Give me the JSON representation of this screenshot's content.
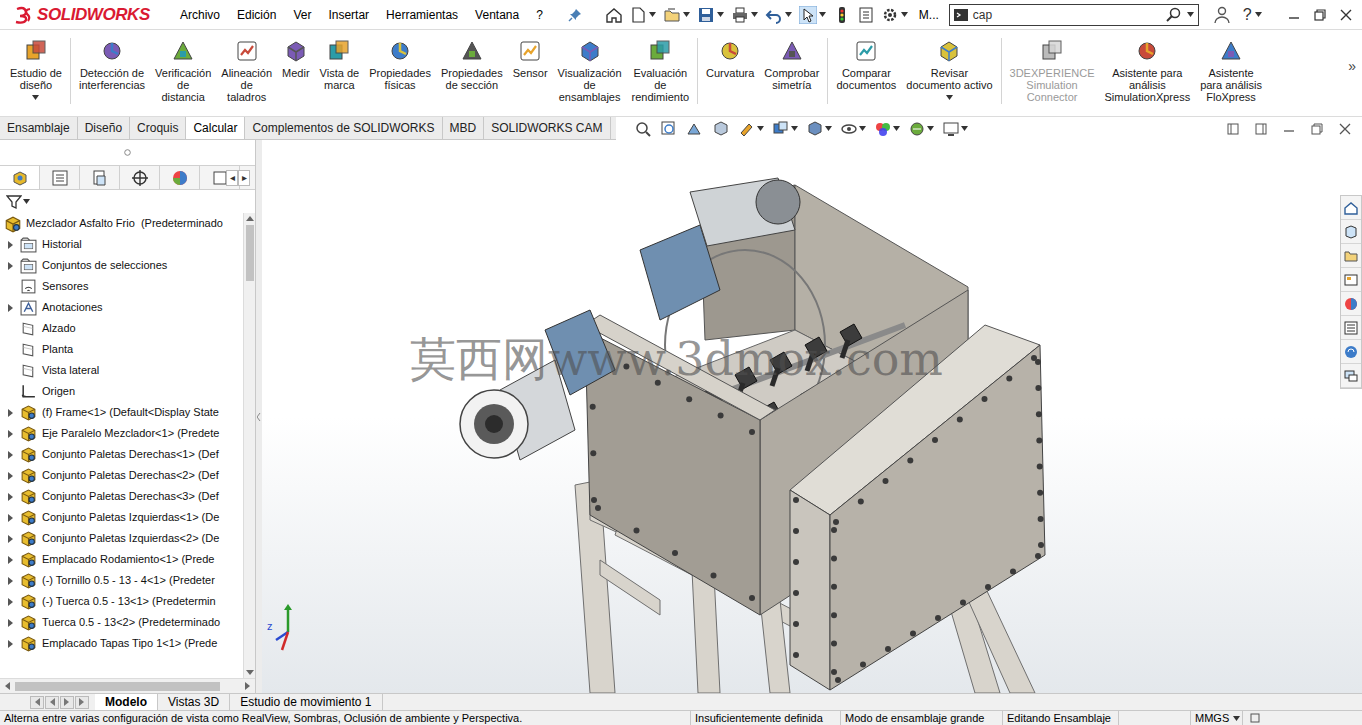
{
  "app": {
    "logo": "SOLIDWORKS"
  },
  "menu": [
    "Archivo",
    "Edición",
    "Ver",
    "Insertar",
    "Herramientas",
    "Ventana",
    "?"
  ],
  "quick_access": {
    "label": "M..."
  },
  "search": {
    "value": "cap"
  },
  "help": "?",
  "ribbon": {
    "groups": [
      [
        {
          "label": "Estudio de\ndiseño",
          "disabled": false,
          "dropdown": true
        }
      ],
      [
        {
          "label": "Detección de\ninterferencias",
          "disabled": false,
          "dropdown": false
        },
        {
          "label": "Verificación\nde\ndistancia",
          "disabled": false,
          "dropdown": false
        },
        {
          "label": "Alineación\nde\ntaladros",
          "disabled": false,
          "dropdown": false
        },
        {
          "label": "Medir",
          "disabled": false,
          "dropdown": false
        },
        {
          "label": "Vista de\nmarca",
          "disabled": false,
          "dropdown": false
        },
        {
          "label": "Propiedades\nfísicas",
          "disabled": false,
          "dropdown": false
        },
        {
          "label": "Propiedades\nde sección",
          "disabled": false,
          "dropdown": false
        },
        {
          "label": "Sensor",
          "disabled": false,
          "dropdown": false
        },
        {
          "label": "Visualización\nde\nensamblajes",
          "disabled": false,
          "dropdown": false
        },
        {
          "label": "Evaluación\nde\nrendimiento",
          "disabled": false,
          "dropdown": false
        }
      ],
      [
        {
          "label": "Curvatura",
          "disabled": false,
          "dropdown": false
        },
        {
          "label": "Comprobar\nsimetría",
          "disabled": false,
          "dropdown": false
        }
      ],
      [
        {
          "label": "Comparar\ndocumentos",
          "disabled": false,
          "dropdown": false
        },
        {
          "label": "Revisar\ndocumento activo",
          "disabled": false,
          "dropdown": true
        }
      ],
      [
        {
          "label": "3DEXPERIENCE\nSimulation\nConnector",
          "disabled": true,
          "dropdown": false
        },
        {
          "label": "Asistente para\nanálisis\nSimulationXpress",
          "disabled": false,
          "dropdown": false
        },
        {
          "label": "Asistente\npara análisis\nFloXpress",
          "disabled": false,
          "dropdown": false
        }
      ]
    ],
    "more": "»"
  },
  "tabs": [
    {
      "label": "Ensamblaje",
      "selected": false
    },
    {
      "label": "Diseño",
      "selected": false
    },
    {
      "label": "Croquis",
      "selected": false
    },
    {
      "label": "Calcular",
      "selected": true
    },
    {
      "label": "Complementos de SOLIDWORKS",
      "selected": false
    },
    {
      "label": "MBD",
      "selected": false
    },
    {
      "label": "SOLIDWORKS CAM",
      "selected": false
    }
  ],
  "tree_tab_scroll": [
    "◂",
    "▸"
  ],
  "feature_tree": {
    "root": "Mezclador Asfalto Frio  (Predeterminado",
    "items": [
      {
        "label": "Historial",
        "kind": "folder",
        "has_children": true
      },
      {
        "label": "Conjuntos de selecciones",
        "kind": "folder",
        "has_children": true
      },
      {
        "label": "Sensores",
        "kind": "sensor",
        "has_children": false
      },
      {
        "label": "Anotaciones",
        "kind": "annotation",
        "has_children": true
      },
      {
        "label": "Alzado",
        "kind": "plane",
        "has_children": false
      },
      {
        "label": "Planta",
        "kind": "plane",
        "has_children": false
      },
      {
        "label": "Vista lateral",
        "kind": "plane",
        "has_children": false
      },
      {
        "label": "Origen",
        "kind": "origin",
        "has_children": false
      },
      {
        "label": "(f) Frame<1> (Default<Display State",
        "kind": "component",
        "has_children": true
      },
      {
        "label": "Eje Paralelo Mezclador<1> (Predete",
        "kind": "component",
        "has_children": true
      },
      {
        "label": "Conjunto Paletas Derechas<1> (Def",
        "kind": "component",
        "has_children": true
      },
      {
        "label": "Conjunto Paletas Derechas<2> (Def",
        "kind": "component",
        "has_children": true
      },
      {
        "label": "Conjunto Paletas Derechas<3> (Def",
        "kind": "component",
        "has_children": true
      },
      {
        "label": "Conjunto Paletas Izquierdas<1> (De",
        "kind": "component",
        "has_children": true
      },
      {
        "label": "Conjunto Paletas Izquierdas<2> (De",
        "kind": "component",
        "has_children": true
      },
      {
        "label": "Emplacado Rodamiento<1> (Prede",
        "kind": "component",
        "has_children": true
      },
      {
        "label": "(-) Tornillo 0.5 - 13 - 4<1> (Predeter",
        "kind": "component",
        "has_children": true
      },
      {
        "label": "(-) Tuerca 0.5 - 13<1> (Predetermin",
        "kind": "component",
        "has_children": true
      },
      {
        "label": "Tuerca 0.5 - 13<2> (Predeterminado",
        "kind": "component",
        "has_children": true
      },
      {
        "label": "Emplacado Tapas Tipo 1<1> (Prede",
        "kind": "component",
        "has_children": true
      }
    ]
  },
  "watermark": "莫西网www.3dmox.com",
  "triad_labels": [
    "z"
  ],
  "bottom_tabs": [
    {
      "label": "Modelo",
      "selected": true
    },
    {
      "label": "Vistas 3D",
      "selected": false
    },
    {
      "label": "Estudio de movimiento 1",
      "selected": false
    }
  ],
  "status_bar": {
    "hint": "Alterna entre varias configuración de vista como RealView, Sombras, Oclusión de ambiente y Perspectiva.",
    "fields": [
      {
        "text": "Insuficientemente definida",
        "dropdown": false
      },
      {
        "text": "Modo de ensamblaje grande",
        "dropdown": false
      },
      {
        "text": "Editando Ensamblaje",
        "dropdown": false
      },
      {
        "text": "",
        "dropdown": false
      },
      {
        "text": "MMGS",
        "dropdown": true
      }
    ]
  }
}
